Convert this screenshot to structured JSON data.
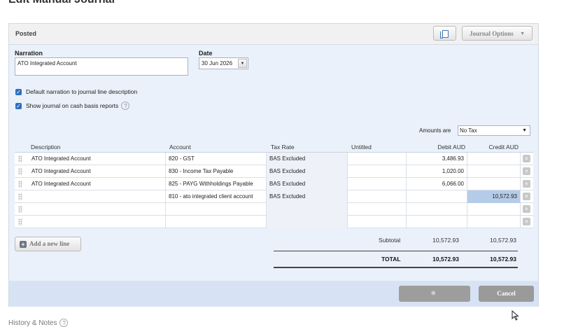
{
  "page": {
    "title": "Edit Manual Journal"
  },
  "status": {
    "label": "Posted"
  },
  "toolbar": {
    "options_label": "Journal Options",
    "copy_icon": "copy-icon"
  },
  "form": {
    "narration_label": "Narration",
    "narration_value": "ATO Integrated Account",
    "date_label": "Date",
    "date_value": "30 Jun 2026",
    "default_narration_label": "Default narration to journal line description",
    "default_narration_checked": true,
    "cash_basis_label": "Show journal on cash basis reports",
    "cash_basis_checked": true,
    "amounts_label": "Amounts are",
    "amounts_value": "No Tax"
  },
  "grid": {
    "headers": {
      "description": "Description",
      "account": "Account",
      "tax_rate": "Tax Rate",
      "untitled": "Untitled",
      "debit": "Debit AUD",
      "credit": "Credit AUD"
    },
    "rows": [
      {
        "description": "ATO Integrated Account",
        "account": "820 - GST",
        "tax_rate": "BAS Excluded",
        "untitled": "",
        "debit": "3,486.93",
        "credit": ""
      },
      {
        "description": "ATO Integrated Account",
        "account": "830 - Income Tax Payable",
        "tax_rate": "BAS Excluded",
        "untitled": "",
        "debit": "1,020.00",
        "credit": ""
      },
      {
        "description": "ATO Integrated Account",
        "account": "825 - PAYG Withholdings Payable",
        "tax_rate": "BAS Excluded",
        "untitled": "",
        "debit": "6,066.00",
        "credit": ""
      },
      {
        "description": "",
        "account": "810 - ato integrated client account",
        "tax_rate": "BAS Excluded",
        "untitled": "",
        "debit": "",
        "credit": "10,572.93"
      },
      {
        "description": "",
        "account": "",
        "tax_rate": "",
        "untitled": "",
        "debit": "",
        "credit": ""
      },
      {
        "description": "",
        "account": "",
        "tax_rate": "",
        "untitled": "",
        "debit": "",
        "credit": ""
      }
    ]
  },
  "add_line_label": "Add a new line",
  "totals": {
    "subtotal_label": "Subtotal",
    "subtotal_debit": "10,572.93",
    "subtotal_credit": "10,572.93",
    "total_label": "TOTAL",
    "total_debit": "10,572.93",
    "total_credit": "10,572.93"
  },
  "footer": {
    "cancel_label": "Cancel"
  },
  "history": {
    "label": "History & Notes"
  },
  "colors": {
    "panel_bg": "#eaf1fa",
    "footer_bg": "#d7e3f4",
    "selected_cell": "#b5cce8",
    "checkbox": "#2f6fbf"
  }
}
